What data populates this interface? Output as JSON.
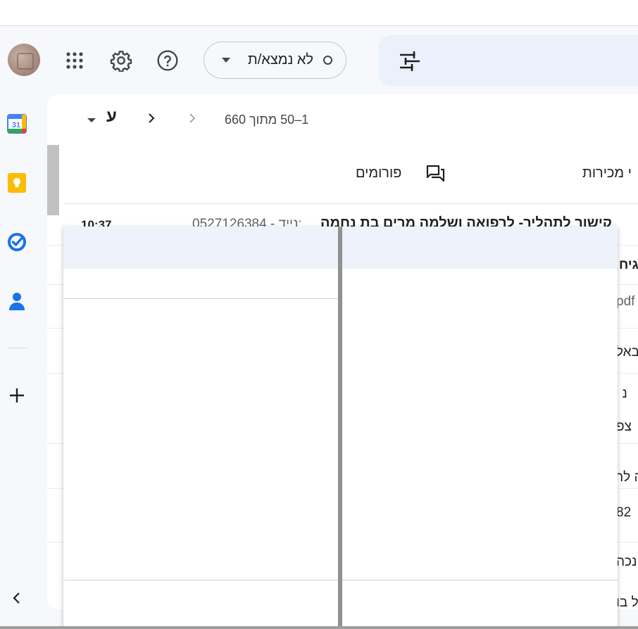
{
  "header": {
    "status_label": "לא נמצא/ת",
    "icons": [
      "apps-icon",
      "settings-icon",
      "help-icon",
      "tune-icon"
    ]
  },
  "rail": {
    "calendar_day": "31",
    "items": [
      "calendar",
      "keep",
      "tasks",
      "contacts",
      "add"
    ]
  },
  "toolbar": {
    "select_letter": "ע",
    "pagination": "1–50 מתוך 660"
  },
  "tabs": {
    "forums": "פורומים",
    "promotions_partial": "י מכירות"
  },
  "mail": {
    "time": "10:37",
    "snippet": "0527126384 - נייד:",
    "subject": "קישור לתהליך- לרפואה ושלמה מרים בת נחמה"
  },
  "visible_fragments": [
    "גיח",
    "pdf",
    "באל",
    "☆ נ",
    "צפ",
    "ה לר",
    "82",
    "ינכה",
    "ל בו"
  ],
  "colors": {
    "accent": "#0b57d0",
    "search_bg": "#eaf1fb",
    "page_bg": "#f6f8fc"
  }
}
